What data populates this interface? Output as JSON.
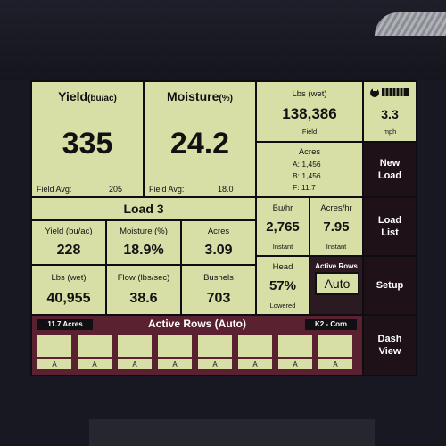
{
  "yield_panel": {
    "title": "Yield",
    "unit": "(bu/ac)",
    "value": "335",
    "avg_label": "Field Avg:",
    "avg_value": "205"
  },
  "moisture_panel": {
    "title": "Moisture",
    "unit": "(%)",
    "value": "24.2",
    "avg_label": "Field Avg:",
    "avg_value": "18.0"
  },
  "lbs_panel": {
    "label": "Lbs (wet)",
    "value": "138,386",
    "sub": "Field"
  },
  "speed_panel": {
    "value": "3.3",
    "unit": "mph"
  },
  "acres_panel": {
    "label": "Acres",
    "a": "A: 1,456",
    "b": "B: 1,456",
    "f": "F: 11.7"
  },
  "load_panel": {
    "title": "Load 3",
    "yield_label": "Yield (bu/ac)",
    "yield_value": "228",
    "moisture_label": "Moisture (%)",
    "moisture_value": "18.9%",
    "acres_label": "Acres",
    "acres_value": "3.09",
    "lbs_label": "Lbs (wet)",
    "lbs_value": "40,955",
    "flow_label": "Flow (lbs/sec)",
    "flow_value": "38.6",
    "bushels_label": "Bushels",
    "bushels_value": "703"
  },
  "bu_hr": {
    "label": "Bu/hr",
    "value": "2,765",
    "sub": "Instant"
  },
  "acres_hr": {
    "label": "Acres/hr",
    "value": "7.95",
    "sub": "Instant"
  },
  "head": {
    "label": "Head",
    "value": "57%",
    "sub": "Lowered"
  },
  "active_rows_panel": {
    "label": "Active Rows",
    "button": "Auto"
  },
  "rows_bar": {
    "acres": "11.7 Acres",
    "title": "Active Rows (Auto)",
    "crop": "K2 - Corn",
    "rows": [
      "A",
      "A",
      "A",
      "A",
      "A",
      "A",
      "A",
      "A"
    ]
  },
  "sidebar": {
    "new_load": "New\nLoad",
    "load_list": "Load\nList",
    "setup": "Setup",
    "dash_view": "Dash\nView"
  }
}
